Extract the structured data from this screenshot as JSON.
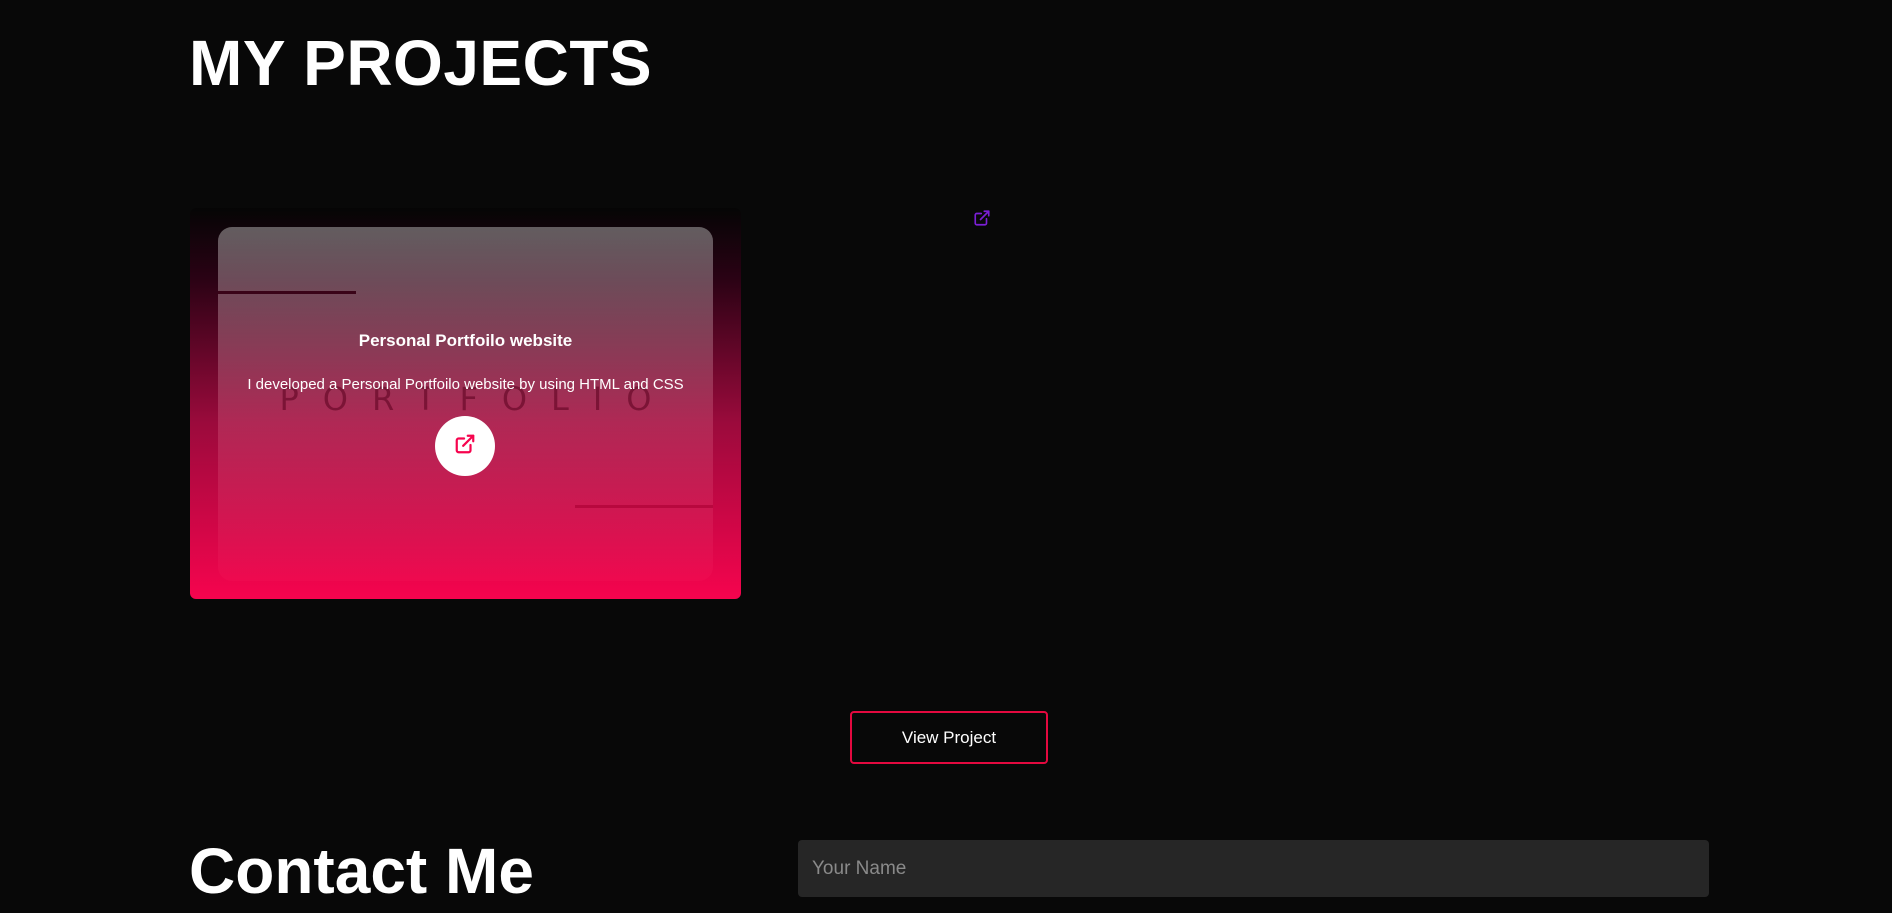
{
  "projects": {
    "heading": "MY PROJECTS",
    "card": {
      "title": "Personal Portfoilo website",
      "description": "I developed a Personal Portfoilo website by using HTML and CSS",
      "watermark": "PORTFOLIO",
      "link_icon": "external-link-icon"
    },
    "floating_link_icon": "external-link-icon",
    "view_button_label": "View Project"
  },
  "contact": {
    "heading": "Contact Me",
    "name_placeholder": "Your Name"
  },
  "colors": {
    "background": "#080808",
    "accent": "#f6044e",
    "accent_border": "#e3093f",
    "floating_icon": "#7b1fd6",
    "input_bg": "#262626"
  }
}
